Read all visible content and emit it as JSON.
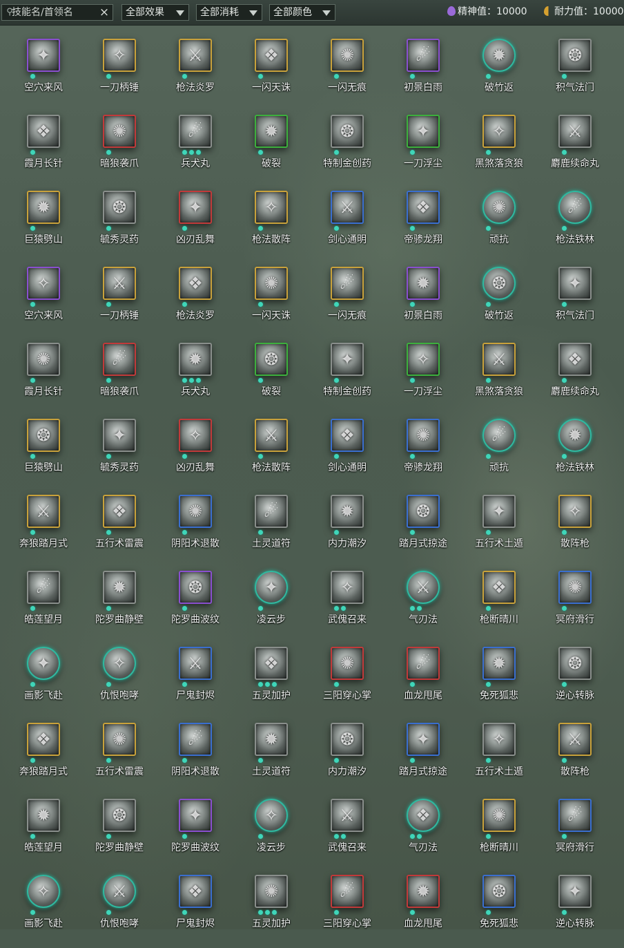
{
  "toolbar": {
    "search_placeholder": "技能名/首领名",
    "clear": "×",
    "filters": [
      {
        "label": "全部效果"
      },
      {
        "label": "全部消耗"
      },
      {
        "label": "全部颜色"
      }
    ],
    "spirit": {
      "label": "精神值：10000",
      "color": "#9a6ad8",
      "icon": "spirit-flame-icon"
    },
    "endurance": {
      "label": "耐力值：10000",
      "color": "#d7a12f",
      "icon": "endurance-moon-icon"
    }
  },
  "colors": {
    "purple": "#8a4fd0",
    "gold": "#c9a23b",
    "red": "#c23a3a",
    "green": "#3db03d",
    "blue": "#3a6fd0",
    "teal": "#2fb9a0",
    "gray": "#8a8f8c",
    "dot": "#3fd6b9"
  },
  "rows": [
    [
      {
        "name": "空穴来风",
        "frame": "purple",
        "shape": "square",
        "dots": 1,
        "icon": "wind-icon"
      },
      {
        "name": "一刀柄锤",
        "frame": "gold",
        "shape": "square",
        "dots": 1,
        "icon": "blade-icon"
      },
      {
        "name": "枪法炎罗",
        "frame": "gold",
        "shape": "square",
        "dots": 1,
        "icon": "spear-icon"
      },
      {
        "name": "一闪天诛",
        "frame": "gold",
        "shape": "square",
        "dots": 1,
        "icon": "strike-icon"
      },
      {
        "name": "一闪无痕",
        "frame": "gold",
        "shape": "square",
        "dots": 1,
        "icon": "slash-icon"
      },
      {
        "name": "初景白雨",
        "frame": "purple",
        "shape": "square",
        "dots": 1,
        "icon": "rain-icon"
      },
      {
        "name": "破竹返",
        "frame": "teal",
        "shape": "circle",
        "dots": 1,
        "icon": "counter-icon"
      },
      {
        "name": "积气法门",
        "frame": "gray",
        "shape": "square",
        "dots": 1,
        "icon": "qi-icon"
      }
    ],
    [
      {
        "name": "霞月长针",
        "frame": "gray",
        "shape": "square",
        "dots": 1,
        "icon": "needle-icon"
      },
      {
        "name": "暗狼袭爪",
        "frame": "red",
        "shape": "square",
        "dots": 1,
        "icon": "claw-icon"
      },
      {
        "name": "兵犬丸",
        "frame": "gray",
        "shape": "square",
        "dots": 3,
        "icon": "dog-icon"
      },
      {
        "name": "破裂",
        "frame": "green",
        "shape": "square",
        "dots": 1,
        "icon": "shatter-icon"
      },
      {
        "name": "特制金创药",
        "frame": "gray",
        "shape": "square",
        "dots": 1,
        "icon": "medicine-icon"
      },
      {
        "name": "一刀浮尘",
        "frame": "green",
        "shape": "square",
        "dots": 1,
        "icon": "dust-icon"
      },
      {
        "name": "黑煞落贪狼",
        "frame": "gold",
        "shape": "square",
        "dots": 1,
        "icon": "wolf-icon"
      },
      {
        "name": "麝鹿续命丸",
        "frame": "gray",
        "shape": "square",
        "dots": 1,
        "icon": "pill-icon"
      }
    ],
    [
      {
        "name": "巨猿劈山",
        "frame": "gold",
        "shape": "square",
        "dots": 1,
        "icon": "ape-icon"
      },
      {
        "name": "毓秀灵药",
        "frame": "gray",
        "shape": "square",
        "dots": 1,
        "icon": "gourd-icon"
      },
      {
        "name": "凶刃乱舞",
        "frame": "red",
        "shape": "square",
        "dots": 1,
        "icon": "blades-icon"
      },
      {
        "name": "枪法散阵",
        "frame": "gold",
        "shape": "square",
        "dots": 1,
        "icon": "spear-icon"
      },
      {
        "name": "剑心通明",
        "frame": "blue",
        "shape": "square",
        "dots": 1,
        "icon": "sword-icon"
      },
      {
        "name": "帝骖龙翔",
        "frame": "blue",
        "shape": "square",
        "dots": 1,
        "icon": "dragon-icon"
      },
      {
        "name": "顽抗",
        "frame": "teal",
        "shape": "circle",
        "dots": 1,
        "icon": "resist-icon"
      },
      {
        "name": "枪法铁林",
        "frame": "teal",
        "shape": "circle",
        "dots": 1,
        "icon": "iron-forest-icon"
      }
    ],
    [
      {
        "name": "空穴来风",
        "frame": "purple",
        "shape": "square",
        "dots": 1,
        "icon": "wind-icon"
      },
      {
        "name": "一刀柄锤",
        "frame": "gold",
        "shape": "square",
        "dots": 1,
        "icon": "blade-icon"
      },
      {
        "name": "枪法炎罗",
        "frame": "gold",
        "shape": "square",
        "dots": 1,
        "icon": "spear-icon"
      },
      {
        "name": "一闪天诛",
        "frame": "gold",
        "shape": "square",
        "dots": 1,
        "icon": "strike-icon"
      },
      {
        "name": "一闪无痕",
        "frame": "gold",
        "shape": "square",
        "dots": 1,
        "icon": "slash-icon"
      },
      {
        "name": "初景白雨",
        "frame": "purple",
        "shape": "square",
        "dots": 1,
        "icon": "rain-icon"
      },
      {
        "name": "破竹返",
        "frame": "teal",
        "shape": "circle",
        "dots": 1,
        "icon": "counter-icon"
      },
      {
        "name": "积气法门",
        "frame": "gray",
        "shape": "square",
        "dots": 1,
        "icon": "qi-icon"
      }
    ],
    [
      {
        "name": "霞月长针",
        "frame": "gray",
        "shape": "square",
        "dots": 1,
        "icon": "needle-icon"
      },
      {
        "name": "暗狼袭爪",
        "frame": "red",
        "shape": "square",
        "dots": 1,
        "icon": "claw-icon"
      },
      {
        "name": "兵犬丸",
        "frame": "gray",
        "shape": "square",
        "dots": 3,
        "icon": "dog-icon"
      },
      {
        "name": "破裂",
        "frame": "green",
        "shape": "square",
        "dots": 1,
        "icon": "shatter-icon"
      },
      {
        "name": "特制金创药",
        "frame": "gray",
        "shape": "square",
        "dots": 1,
        "icon": "medicine-icon"
      },
      {
        "name": "一刀浮尘",
        "frame": "green",
        "shape": "square",
        "dots": 1,
        "icon": "dust-icon"
      },
      {
        "name": "黑煞落贪狼",
        "frame": "gold",
        "shape": "square",
        "dots": 1,
        "icon": "wolf-icon"
      },
      {
        "name": "麝鹿续命丸",
        "frame": "gray",
        "shape": "square",
        "dots": 1,
        "icon": "pill-icon"
      }
    ],
    [
      {
        "name": "巨猿劈山",
        "frame": "gold",
        "shape": "square",
        "dots": 1,
        "icon": "ape-icon"
      },
      {
        "name": "毓秀灵药",
        "frame": "gray",
        "shape": "square",
        "dots": 1,
        "icon": "gourd-icon"
      },
      {
        "name": "凶刃乱舞",
        "frame": "red",
        "shape": "square",
        "dots": 1,
        "icon": "blades-icon"
      },
      {
        "name": "枪法散阵",
        "frame": "gold",
        "shape": "square",
        "dots": 1,
        "icon": "spear-icon"
      },
      {
        "name": "剑心通明",
        "frame": "blue",
        "shape": "square",
        "dots": 1,
        "icon": "sword-icon"
      },
      {
        "name": "帝骖龙翔",
        "frame": "blue",
        "shape": "square",
        "dots": 1,
        "icon": "dragon-icon"
      },
      {
        "name": "顽抗",
        "frame": "teal",
        "shape": "circle",
        "dots": 1,
        "icon": "resist-icon"
      },
      {
        "name": "枪法铁林",
        "frame": "teal",
        "shape": "circle",
        "dots": 1,
        "icon": "iron-forest-icon"
      }
    ],
    [
      {
        "name": "奔狼踏月式",
        "frame": "gold",
        "shape": "square",
        "dots": 1,
        "icon": "wolf-moon-icon"
      },
      {
        "name": "五行术雷震",
        "frame": "gold",
        "shape": "square",
        "dots": 1,
        "icon": "thunder-icon"
      },
      {
        "name": "阴阳术退散",
        "frame": "blue",
        "shape": "square",
        "dots": 1,
        "icon": "yinyang-icon"
      },
      {
        "name": "土灵道符",
        "frame": "gray",
        "shape": "square",
        "dots": 1,
        "icon": "talisman-icon"
      },
      {
        "name": "内力潮汐",
        "frame": "gray",
        "shape": "square",
        "dots": 1,
        "icon": "tide-icon"
      },
      {
        "name": "踏月式掠途",
        "frame": "blue",
        "shape": "square",
        "dots": 1,
        "icon": "moon-step-icon"
      },
      {
        "name": "五行术土遁",
        "frame": "gray",
        "shape": "square",
        "dots": 1,
        "icon": "earth-icon"
      },
      {
        "name": "散阵枪",
        "frame": "gold",
        "shape": "square",
        "dots": 1,
        "icon": "spear-icon"
      }
    ],
    [
      {
        "name": "皓莲望月",
        "frame": "gray",
        "shape": "square",
        "dots": 1,
        "icon": "crescent-icon"
      },
      {
        "name": "陀罗曲静壁",
        "frame": "gray",
        "shape": "square",
        "dots": 1,
        "icon": "dancer-icon"
      },
      {
        "name": "陀罗曲波纹",
        "frame": "purple",
        "shape": "square",
        "dots": 1,
        "icon": "ripple-icon"
      },
      {
        "name": "凌云步",
        "frame": "teal",
        "shape": "circle",
        "dots": 1,
        "icon": "cloud-step-icon"
      },
      {
        "name": "武傀召来",
        "frame": "gray",
        "shape": "square",
        "dots": 2,
        "icon": "puppet-icon"
      },
      {
        "name": "气刃法",
        "frame": "teal",
        "shape": "circle",
        "dots": 2,
        "icon": "qi-blade-icon"
      },
      {
        "name": "枪断晴川",
        "frame": "gold",
        "shape": "square",
        "dots": 1,
        "icon": "spear-icon"
      },
      {
        "name": "冥府滑行",
        "frame": "blue",
        "shape": "square",
        "dots": 1,
        "icon": "glide-icon"
      }
    ],
    [
      {
        "name": "画影飞赴",
        "frame": "teal",
        "shape": "circle",
        "dots": 1,
        "icon": "shadow-icon"
      },
      {
        "name": "仇恨咆哮",
        "frame": "teal",
        "shape": "circle",
        "dots": 1,
        "icon": "roar-icon"
      },
      {
        "name": "尸鬼封烬",
        "frame": "blue",
        "shape": "square",
        "dots": 1,
        "icon": "ghost-fire-icon"
      },
      {
        "name": "五灵加护",
        "frame": "gray",
        "shape": "square",
        "dots": 3,
        "icon": "shrine-icon"
      },
      {
        "name": "三阳穿心掌",
        "frame": "red",
        "shape": "square",
        "dots": 1,
        "icon": "palm-icon"
      },
      {
        "name": "血龙甩尾",
        "frame": "red",
        "shape": "square",
        "dots": 1,
        "icon": "tail-icon"
      },
      {
        "name": "免死狐悲",
        "frame": "blue",
        "shape": "square",
        "dots": 1,
        "icon": "fox-icon"
      },
      {
        "name": "逆心转脉",
        "frame": "gray",
        "shape": "square",
        "dots": 1,
        "icon": "vortex-icon"
      }
    ],
    [
      {
        "name": "奔狼踏月式",
        "frame": "gold",
        "shape": "square",
        "dots": 1,
        "icon": "wolf-moon-icon"
      },
      {
        "name": "五行术雷震",
        "frame": "gold",
        "shape": "square",
        "dots": 1,
        "icon": "thunder-icon"
      },
      {
        "name": "阴阳术退散",
        "frame": "blue",
        "shape": "square",
        "dots": 1,
        "icon": "yinyang-icon"
      },
      {
        "name": "土灵道符",
        "frame": "gray",
        "shape": "square",
        "dots": 1,
        "icon": "talisman-icon"
      },
      {
        "name": "内力潮汐",
        "frame": "gray",
        "shape": "square",
        "dots": 1,
        "icon": "tide-icon"
      },
      {
        "name": "踏月式掠途",
        "frame": "blue",
        "shape": "square",
        "dots": 1,
        "icon": "moon-step-icon"
      },
      {
        "name": "五行术土遁",
        "frame": "gray",
        "shape": "square",
        "dots": 1,
        "icon": "earth-icon"
      },
      {
        "name": "散阵枪",
        "frame": "gold",
        "shape": "square",
        "dots": 1,
        "icon": "spear-icon"
      }
    ],
    [
      {
        "name": "皓莲望月",
        "frame": "gray",
        "shape": "square",
        "dots": 1,
        "icon": "crescent-icon"
      },
      {
        "name": "陀罗曲静壁",
        "frame": "gray",
        "shape": "square",
        "dots": 1,
        "icon": "dancer-icon"
      },
      {
        "name": "陀罗曲波纹",
        "frame": "purple",
        "shape": "square",
        "dots": 1,
        "icon": "ripple-icon"
      },
      {
        "name": "凌云步",
        "frame": "teal",
        "shape": "circle",
        "dots": 1,
        "icon": "cloud-step-icon"
      },
      {
        "name": "武傀召来",
        "frame": "gray",
        "shape": "square",
        "dots": 2,
        "icon": "puppet-icon"
      },
      {
        "name": "气刃法",
        "frame": "teal",
        "shape": "circle",
        "dots": 2,
        "icon": "qi-blade-icon"
      },
      {
        "name": "枪断晴川",
        "frame": "gold",
        "shape": "square",
        "dots": 1,
        "icon": "spear-icon"
      },
      {
        "name": "冥府滑行",
        "frame": "blue",
        "shape": "square",
        "dots": 1,
        "icon": "glide-icon"
      }
    ],
    [
      {
        "name": "画影飞赴",
        "frame": "teal",
        "shape": "circle",
        "dots": 1,
        "icon": "shadow-icon"
      },
      {
        "name": "仇恨咆哮",
        "frame": "teal",
        "shape": "circle",
        "dots": 1,
        "icon": "roar-icon"
      },
      {
        "name": "尸鬼封烬",
        "frame": "blue",
        "shape": "square",
        "dots": 1,
        "icon": "ghost-fire-icon"
      },
      {
        "name": "五灵加护",
        "frame": "gray",
        "shape": "square",
        "dots": 3,
        "icon": "shrine-icon"
      },
      {
        "name": "三阳穿心掌",
        "frame": "red",
        "shape": "square",
        "dots": 1,
        "icon": "palm-icon"
      },
      {
        "name": "血龙甩尾",
        "frame": "red",
        "shape": "square",
        "dots": 1,
        "icon": "tail-icon"
      },
      {
        "name": "免死狐悲",
        "frame": "blue",
        "shape": "square",
        "dots": 1,
        "icon": "fox-icon"
      },
      {
        "name": "逆心转脉",
        "frame": "gray",
        "shape": "square",
        "dots": 1,
        "icon": "vortex-icon"
      }
    ]
  ]
}
